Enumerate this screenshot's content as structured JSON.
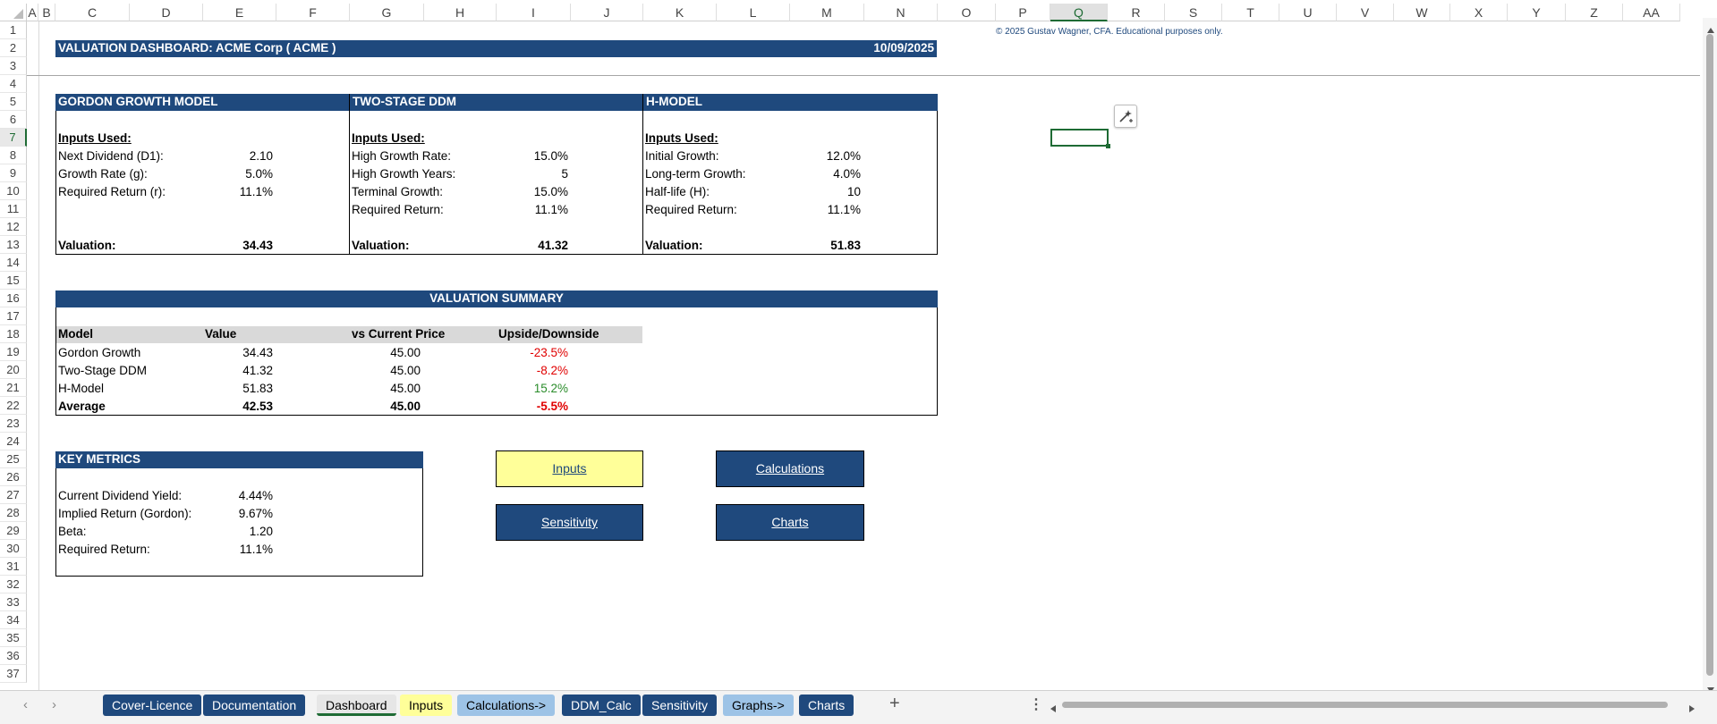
{
  "columns": [
    "A",
    "B",
    "C",
    "D",
    "E",
    "F",
    "G",
    "H",
    "I",
    "J",
    "K",
    "L",
    "M",
    "N",
    "O",
    "P",
    "Q",
    "R",
    "S",
    "T",
    "U",
    "V",
    "W",
    "X",
    "Y",
    "Z",
    "AA"
  ],
  "rows": [
    "1",
    "2",
    "3",
    "4",
    "5",
    "6",
    "7",
    "8",
    "9",
    "10",
    "11",
    "12",
    "13",
    "14",
    "15",
    "16",
    "17",
    "18",
    "19",
    "20",
    "21",
    "22",
    "23",
    "24",
    "25",
    "26",
    "27",
    "28",
    "29",
    "30",
    "31",
    "32",
    "33",
    "34",
    "35",
    "36",
    "37"
  ],
  "selected": {
    "column": "Q",
    "row": "7"
  },
  "header": {
    "title": "VALUATION DASHBOARD: ACME Corp ( ACME )",
    "date": "10/09/2025",
    "copyright": "© 2025 Gustav Wagner, CFA. Educational purposes only."
  },
  "gordon": {
    "title": "GORDON GROWTH MODEL",
    "inputs_label": "Inputs Used:",
    "rows": [
      {
        "label": "Next Dividend (D1):",
        "value": "2.10"
      },
      {
        "label": "Growth Rate (g):",
        "value": "5.0%"
      },
      {
        "label": "Required Return (r):",
        "value": "11.1%"
      }
    ],
    "valuation_label": "Valuation:",
    "valuation": "34.43"
  },
  "two_stage": {
    "title": "TWO-STAGE DDM",
    "inputs_label": "Inputs Used:",
    "rows": [
      {
        "label": "High Growth Rate:",
        "value": "15.0%"
      },
      {
        "label": "High Growth Years:",
        "value": "5"
      },
      {
        "label": "Terminal Growth:",
        "value": "15.0%"
      },
      {
        "label": "Required Return:",
        "value": "11.1%"
      }
    ],
    "valuation_label": "Valuation:",
    "valuation": "41.32"
  },
  "h_model": {
    "title": "H-MODEL",
    "inputs_label": "Inputs Used:",
    "rows": [
      {
        "label": "Initial Growth:",
        "value": "12.0%"
      },
      {
        "label": "Long-term Growth:",
        "value": "4.0%"
      },
      {
        "label": "Half-life (H):",
        "value": "10"
      },
      {
        "label": "Required Return:",
        "value": "11.1%"
      }
    ],
    "valuation_label": "Valuation:",
    "valuation": "51.83"
  },
  "summary": {
    "title": "VALUATION SUMMARY",
    "headers": [
      "Model",
      "Value",
      "vs Current Price",
      "Upside/Downside"
    ],
    "rows": [
      {
        "model": "Gordon Growth",
        "value": "34.43",
        "price": "45.00",
        "updown": "-23.5%",
        "status": "negative"
      },
      {
        "model": "Two-Stage DDM",
        "value": "41.32",
        "price": "45.00",
        "updown": "-8.2%",
        "status": "negative"
      },
      {
        "model": "H-Model",
        "value": "51.83",
        "price": "45.00",
        "updown": "15.2%",
        "status": "positive"
      },
      {
        "model": "Average",
        "value": "42.53",
        "price": "45.00",
        "updown": "-5.5%",
        "status": "negative"
      }
    ]
  },
  "key_metrics": {
    "title": "KEY METRICS",
    "rows": [
      {
        "label": "Current Dividend Yield:",
        "value": "4.44%"
      },
      {
        "label": "Implied Return (Gordon):",
        "value": "9.67%"
      },
      {
        "label": "Beta:",
        "value": "1.20"
      },
      {
        "label": "Required Return:",
        "value": "11.1%"
      }
    ]
  },
  "nav_buttons": {
    "inputs": "Inputs",
    "calculations": "Calculations",
    "sensitivity": "Sensitivity",
    "charts": "Charts"
  },
  "sheet_tabs": [
    {
      "label": "Cover-Licence",
      "style": "dark"
    },
    {
      "label": "Documentation",
      "style": "dark"
    },
    {
      "label": "Dashboard",
      "style": "active"
    },
    {
      "label": "Inputs",
      "style": "yel"
    },
    {
      "label": "Calculations->",
      "style": "light"
    },
    {
      "label": "DDM_Calc",
      "style": "dark"
    },
    {
      "label": "Sensitivity",
      "style": "dark"
    },
    {
      "label": "Graphs->",
      "style": "light"
    },
    {
      "label": "Charts",
      "style": "dark"
    }
  ],
  "icons": {
    "sheet_nav_prev": "chevron-left-icon",
    "sheet_nav_next": "chevron-right-icon",
    "add_sheet": "plus-icon",
    "tab_options": "vertical-ellipsis-icon",
    "scroll_left": "triangle-left-icon",
    "scroll_right": "triangle-right-icon",
    "scroll_up": "triangle-up-icon",
    "scroll_down": "triangle-down-icon",
    "quick_analysis": "magic-wand-icon"
  },
  "colors": {
    "header_blue": "#1f497d",
    "highlight_yellow": "#ffff99",
    "negative_red": "#e00000",
    "positive_green": "#2a8c2a",
    "selection_green": "#1e6b34"
  }
}
